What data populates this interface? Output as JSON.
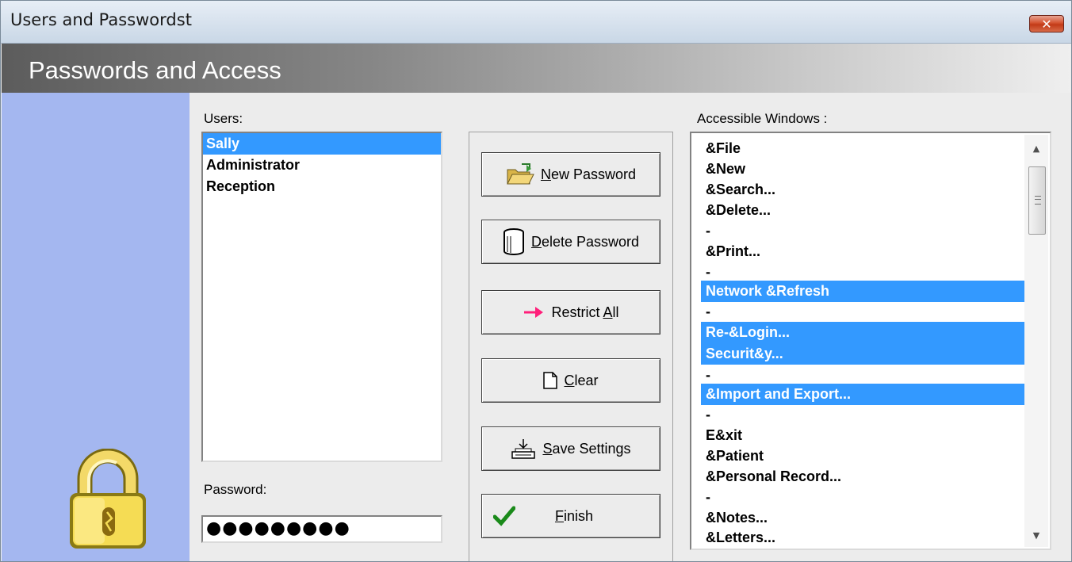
{
  "window": {
    "title": "Users and Passwordst",
    "close_label": "✕"
  },
  "header": {
    "title": "Passwords and Access"
  },
  "users": {
    "label": "Users:",
    "items": [
      {
        "name": "Sally",
        "selected": true
      },
      {
        "name": "Administrator",
        "selected": false
      },
      {
        "name": "Reception",
        "selected": false
      }
    ]
  },
  "password": {
    "label": "Password:",
    "value": "●●●●●●●●●"
  },
  "buttons": {
    "new_password": {
      "mnemonic": "N",
      "rest": "ew Password",
      "icon": "folder-open-icon"
    },
    "delete_password": {
      "mnemonic": "D",
      "rest": "elete Password",
      "icon": "trash-can-icon"
    },
    "restrict_all": {
      "pre": "Restrict ",
      "mnemonic": "A",
      "rest": "ll",
      "icon": "arrow-right-icon"
    },
    "clear": {
      "mnemonic": "C",
      "rest": "lear",
      "icon": "blank-page-icon"
    },
    "save_settings": {
      "mnemonic": "S",
      "rest": "ave Settings",
      "icon": "inbox-save-icon"
    },
    "finish": {
      "mnemonic": "F",
      "rest": "inish",
      "icon": "checkmark-icon"
    }
  },
  "windows": {
    "label": "Accessible Windows :",
    "items": [
      {
        "text": "&File",
        "selected": false
      },
      {
        "text": "&New",
        "selected": false
      },
      {
        "text": "&Search...",
        "selected": false
      },
      {
        "text": "&Delete...",
        "selected": false
      },
      {
        "text": "-",
        "selected": false
      },
      {
        "text": "&Print...",
        "selected": false
      },
      {
        "text": "-",
        "selected": false
      },
      {
        "text": "Network &Refresh",
        "selected": true
      },
      {
        "text": "-",
        "selected": false
      },
      {
        "text": "Re-&Login...",
        "selected": true
      },
      {
        "text": "Securit&y...",
        "selected": true
      },
      {
        "text": "-",
        "selected": false
      },
      {
        "text": "&Import and Export...",
        "selected": true
      },
      {
        "text": "-",
        "selected": false
      },
      {
        "text": "E&xit",
        "selected": false
      },
      {
        "text": "&Patient",
        "selected": false
      },
      {
        "text": "&Personal Record...",
        "selected": false
      },
      {
        "text": "-",
        "selected": false
      },
      {
        "text": "&Notes...",
        "selected": false
      },
      {
        "text": "&Letters...",
        "selected": false
      }
    ]
  },
  "colors": {
    "selection": "#3399ff",
    "left_panel": "#a4b7f0",
    "close_button": "#c23a17"
  }
}
